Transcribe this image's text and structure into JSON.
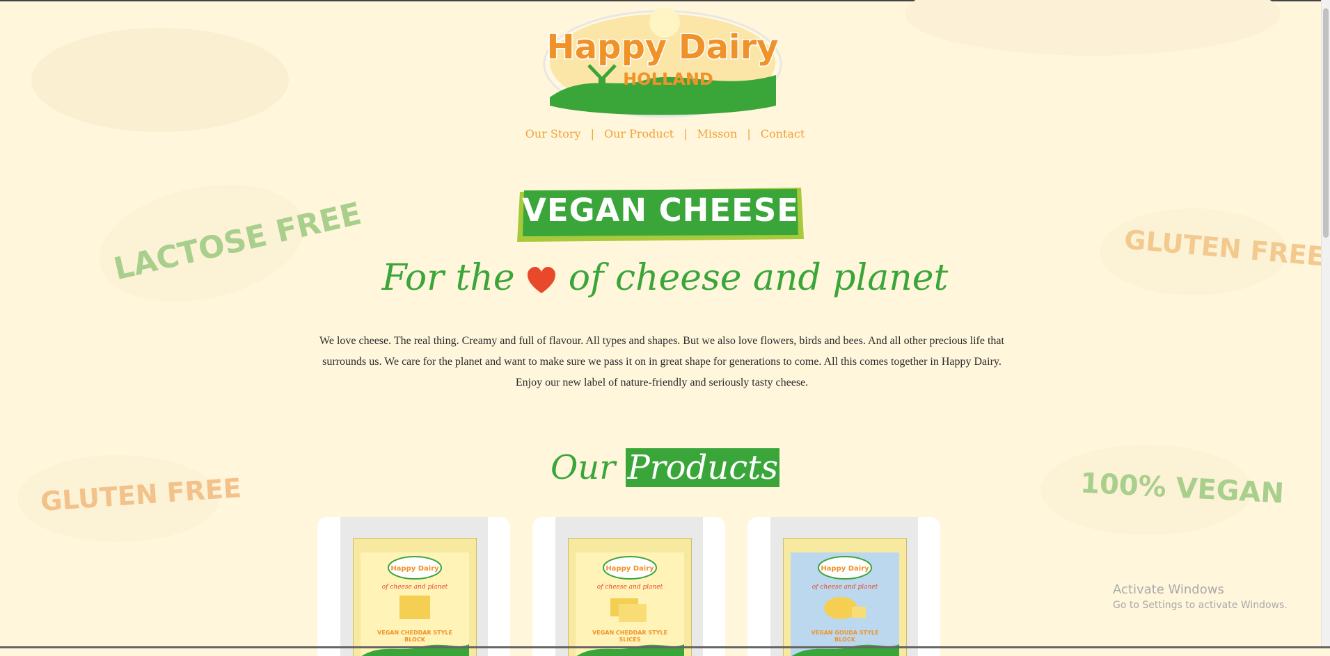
{
  "brand": {
    "logo_line1": "Happy Dairy",
    "logo_line2": "HOLLAND"
  },
  "nav": {
    "items": [
      "Our Story",
      "Our Product",
      "Misson",
      "Contact"
    ],
    "separator": "|"
  },
  "banner": {
    "label": "VEGAN CHEESE"
  },
  "tagline": {
    "before": "For the",
    "after": "of cheese and planet"
  },
  "intro": {
    "text": "We love cheese. The real thing. Creamy and full of flavour. All types and shapes. But we also love flowers, birds and bees. And all other precious life that surrounds us. We care for the planet and want to make sure we pass it on in great shape for generations to come. All this comes together in Happy Dairy. Enjoy our new label of nature-friendly and seriously tasty cheese."
  },
  "products": {
    "heading_plain": "Our",
    "heading_highlight": "Products",
    "items": [
      {
        "name": "VEGAN CHEDDAR STYLE",
        "form": "BLOCK"
      },
      {
        "name": "VEGAN CHEDDAR STYLE",
        "form": "SLICES"
      },
      {
        "name": "VEGAN GOUDA STYLE",
        "form": "BLOCK"
      }
    ]
  },
  "stickers": {
    "lactose_free": "LACTOSE FREE",
    "gluten_free_right": "GLUTEN FREE",
    "gluten_free_left": "GLUTEN FREE",
    "vegan": "100% VEGAN"
  },
  "os_watermark": {
    "line1": "Activate Windows",
    "line2": "Go to Settings to activate Windows."
  },
  "colors": {
    "background": "#fff6dc",
    "green": "#3aa63a",
    "orange": "#f0a23a",
    "heart": "#e8492b"
  }
}
